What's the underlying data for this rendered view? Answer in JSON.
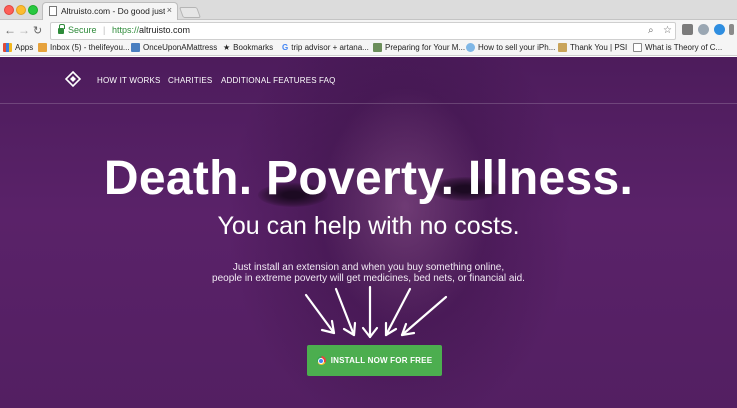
{
  "browser": {
    "tab_title": "Altruisto.com - Do good just by",
    "tab_close": "×",
    "secure_label": "Secure",
    "url_scheme": "https://",
    "url_host": "altruisto.com",
    "bookmarks": [
      {
        "label": "Apps",
        "icon": "apps-grid-icon"
      },
      {
        "label": "Inbox (5) - thelifeyou...",
        "icon": "gmail-icon"
      },
      {
        "label": "OnceUponAMattress",
        "icon": "page-icon"
      },
      {
        "label": "Bookmarks",
        "icon": "star-icon"
      },
      {
        "label": "trip advisor + artana...",
        "icon": "google-icon"
      },
      {
        "label": "Preparing for Your M...",
        "icon": "site-icon"
      },
      {
        "label": "How to sell your iPh...",
        "icon": "globe-icon"
      },
      {
        "label": "Thank You | PSI",
        "icon": "psi-icon"
      },
      {
        "label": "What is Theory of C...",
        "icon": "page-icon"
      }
    ]
  },
  "site": {
    "nav": [
      "HOW IT WORKS",
      "CHARITIES",
      "ADDITIONAL FEATURES",
      "FAQ"
    ],
    "headline": "Death. Poverty. Illness.",
    "subhead": "You can help with no costs.",
    "desc_line1": "Just install an extension and when you buy something online,",
    "desc_line2": "people in extreme poverty will get medicines, bed nets, or financial aid.",
    "cta_label": "INSTALL NOW FOR FREE"
  },
  "colors": {
    "hero_purple": "#5a2269",
    "cta_green": "#4cae4f",
    "secure_green": "#2e8b3a"
  }
}
